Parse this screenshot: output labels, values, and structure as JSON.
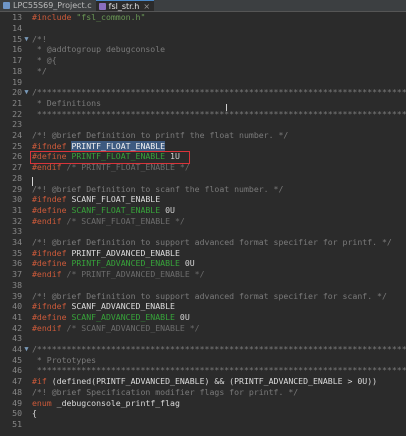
{
  "tabs": [
    {
      "label": "LPC55S69_Project.c",
      "active": false
    },
    {
      "label": "fsl_str.h",
      "active": true
    }
  ],
  "lines": [
    {
      "num": "13",
      "parts": [
        [
          "kw",
          "#include "
        ],
        [
          "str",
          "\"fsl_common.h\""
        ]
      ]
    },
    {
      "num": "14",
      "parts": []
    },
    {
      "num": "15",
      "parts": [
        [
          "cmt",
          "/*!"
        ]
      ],
      "fold": "▼"
    },
    {
      "num": "16",
      "parts": [
        [
          "cmt",
          " * @addtogroup debugconsole"
        ]
      ]
    },
    {
      "num": "17",
      "parts": [
        [
          "cmt",
          " * @{"
        ]
      ]
    },
    {
      "num": "18",
      "parts": [
        [
          "cmt",
          " */"
        ]
      ]
    },
    {
      "num": "19",
      "parts": []
    },
    {
      "num": "20",
      "parts": [
        [
          "cmt",
          "/*******************************************************************************"
        ]
      ],
      "fold": "▼"
    },
    {
      "num": "21",
      "parts": [
        [
          "cmt",
          " * Definitions"
        ]
      ]
    },
    {
      "num": "22",
      "parts": [
        [
          "cmt",
          " ******************************************************************************/"
        ]
      ]
    },
    {
      "num": "23",
      "parts": []
    },
    {
      "num": "24",
      "parts": [
        [
          "cmt",
          "/*! @brief Definition to printf the float number. */"
        ]
      ]
    },
    {
      "num": "25",
      "parts": [
        [
          "kw",
          "#ifndef "
        ],
        [
          "sel",
          "PRINTF_FLOAT_ENABLE"
        ]
      ]
    },
    {
      "num": "26",
      "parts": [
        [
          "kw",
          "#define "
        ],
        [
          "green",
          "PRINTF_FLOAT_ENABLE "
        ],
        [
          "num",
          "1U"
        ]
      ]
    },
    {
      "num": "27",
      "parts": [
        [
          "kw",
          "#endif "
        ],
        [
          "dim",
          "/* PRINTF_FLOAT_ENABLE */"
        ]
      ]
    },
    {
      "num": "28",
      "parts": []
    },
    {
      "num": "29",
      "parts": [
        [
          "cmt",
          "/*! @brief Definition to scanf the float number. */"
        ]
      ]
    },
    {
      "num": "30",
      "parts": [
        [
          "kw",
          "#ifndef "
        ],
        [
          "mac",
          "SCANF_FLOAT_ENABLE"
        ]
      ]
    },
    {
      "num": "31",
      "parts": [
        [
          "kw",
          "#define "
        ],
        [
          "green",
          "SCANF_FLOAT_ENABLE "
        ],
        [
          "num",
          "0U"
        ]
      ]
    },
    {
      "num": "32",
      "parts": [
        [
          "kw",
          "#endif "
        ],
        [
          "dim",
          "/* SCANF_FLOAT_ENABLE */"
        ]
      ]
    },
    {
      "num": "33",
      "parts": []
    },
    {
      "num": "34",
      "parts": [
        [
          "cmt",
          "/*! @brief Definition to support advanced format specifier for printf. */"
        ]
      ]
    },
    {
      "num": "35",
      "parts": [
        [
          "kw",
          "#ifndef "
        ],
        [
          "mac",
          "PRINTF_ADVANCED_ENABLE"
        ]
      ]
    },
    {
      "num": "36",
      "parts": [
        [
          "kw",
          "#define "
        ],
        [
          "green",
          "PRINTF_ADVANCED_ENABLE "
        ],
        [
          "num",
          "0U"
        ]
      ]
    },
    {
      "num": "37",
      "parts": [
        [
          "kw",
          "#endif "
        ],
        [
          "dim",
          "/* PRINTF_ADVANCED_ENABLE */"
        ]
      ]
    },
    {
      "num": "38",
      "parts": []
    },
    {
      "num": "39",
      "parts": [
        [
          "cmt",
          "/*! @brief Definition to support advanced format specifier for scanf. */"
        ]
      ]
    },
    {
      "num": "40",
      "parts": [
        [
          "kw",
          "#ifndef "
        ],
        [
          "mac",
          "SCANF_ADVANCED_ENABLE"
        ]
      ]
    },
    {
      "num": "41",
      "parts": [
        [
          "kw",
          "#define "
        ],
        [
          "green",
          "SCANF_ADVANCED_ENABLE "
        ],
        [
          "num",
          "0U"
        ]
      ]
    },
    {
      "num": "42",
      "parts": [
        [
          "kw",
          "#endif "
        ],
        [
          "dim",
          "/* SCANF_ADVANCED_ENABLE */"
        ]
      ]
    },
    {
      "num": "43",
      "parts": []
    },
    {
      "num": "44",
      "parts": [
        [
          "cmt",
          "/*******************************************************************************"
        ]
      ],
      "fold": "▼"
    },
    {
      "num": "45",
      "parts": [
        [
          "cmt",
          " * Prototypes"
        ]
      ]
    },
    {
      "num": "46",
      "parts": [
        [
          "cmt",
          " ******************************************************************************/"
        ]
      ]
    },
    {
      "num": "47",
      "parts": [
        [
          "kw",
          "#if "
        ],
        [
          "mac",
          "(defined(PRINTF_ADVANCED_ENABLE) && (PRINTF_ADVANCED_ENABLE > 0U))"
        ]
      ]
    },
    {
      "num": "48",
      "parts": [
        [
          "cmt",
          "/*! @brief Specification modifier flags for printf. */"
        ]
      ]
    },
    {
      "num": "49",
      "parts": [
        [
          "kw",
          "enum "
        ],
        [
          "mac",
          "_debugconsole_printf_flag"
        ]
      ]
    },
    {
      "num": "50",
      "parts": [
        [
          "mac",
          "{"
        ]
      ]
    },
    {
      "num": "51",
      "parts": []
    }
  ]
}
